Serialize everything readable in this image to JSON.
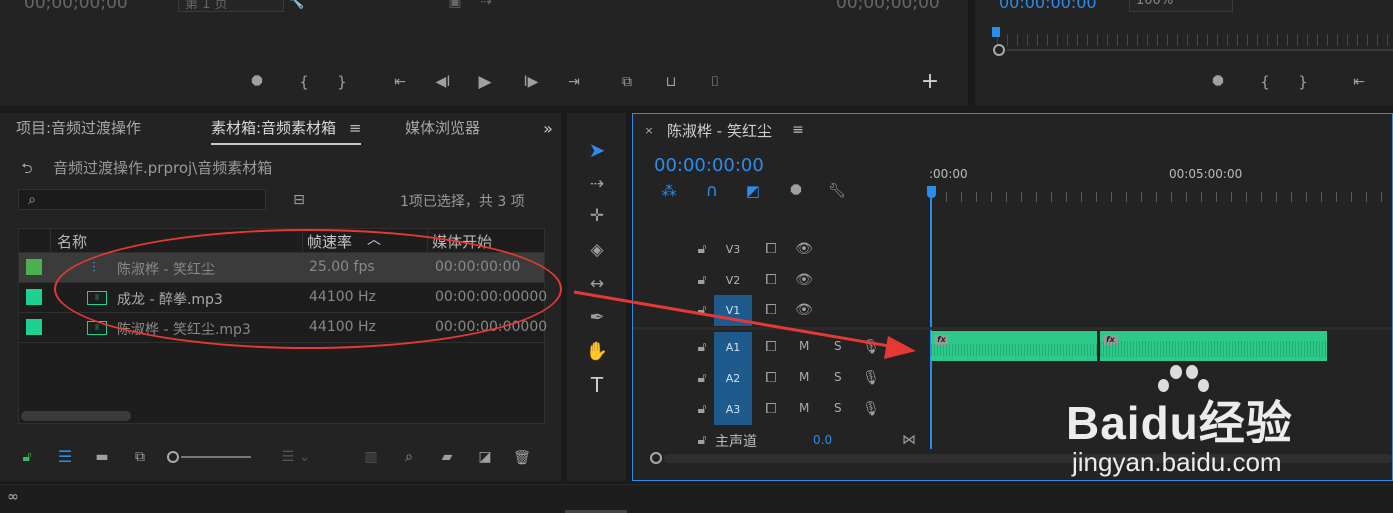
{
  "source_monitor": {
    "timecode_left": "00;00;00;00",
    "page_label": "第 1 页",
    "timecode_right": "00;00;00;00"
  },
  "program_monitor": {
    "timecode": "00:00:00:00",
    "zoom": "100%"
  },
  "project_panel": {
    "tabs": [
      {
        "label": "项目:音频过渡操作"
      },
      {
        "label": "素材箱:音频素材箱"
      },
      {
        "label": "媒体浏览器"
      }
    ],
    "path": "音频过渡操作.prproj\\音频素材箱",
    "search_placeholder": "",
    "selection_info": "1项已选择，共 3 项",
    "columns": {
      "name": "名称",
      "fps": "帧速率",
      "start": "媒体开始"
    },
    "rows": [
      {
        "name": "陈淑桦 - 笑红尘",
        "rate": "25.00 fps",
        "start": "00:00:00:00",
        "color": "#4caf50",
        "type": "sequence"
      },
      {
        "name": "成龙 - 醉拳.mp3",
        "rate": "44100 Hz",
        "start": "00:00:00:00000",
        "color": "#1fd190",
        "type": "audio"
      },
      {
        "name": "陈淑桦 - 笑红尘.mp3",
        "rate": "44100 Hz",
        "start": "00:00:00:00000",
        "color": "#1fd190",
        "type": "audio"
      }
    ]
  },
  "tools": [
    "selection-tool",
    "track-select-tool",
    "ripple-edit-tool",
    "razor-tool",
    "slip-tool",
    "pen-tool",
    "hand-tool",
    "type-tool"
  ],
  "timeline": {
    "sequence_name": "陈淑桦 - 笑红尘",
    "timecode": "00:00:00:00",
    "ruler": {
      "start": ":00:00",
      "mid": "00:05:00:00"
    },
    "video_tracks": [
      "V3",
      "V2",
      "V1"
    ],
    "audio_tracks": [
      "A1",
      "A2",
      "A3"
    ],
    "audio_controls": {
      "mute": "M",
      "solo": "S"
    },
    "master": {
      "label": "主声道",
      "value": "0.0"
    },
    "clip_fx_label": "fx"
  },
  "watermark": {
    "brand": "Baidu经验",
    "url": "jingyan.baidu.com"
  },
  "colors": {
    "accent": "#2d8ceb",
    "audio_clip": "#2cc98a",
    "annotation_red": "#e53935"
  }
}
